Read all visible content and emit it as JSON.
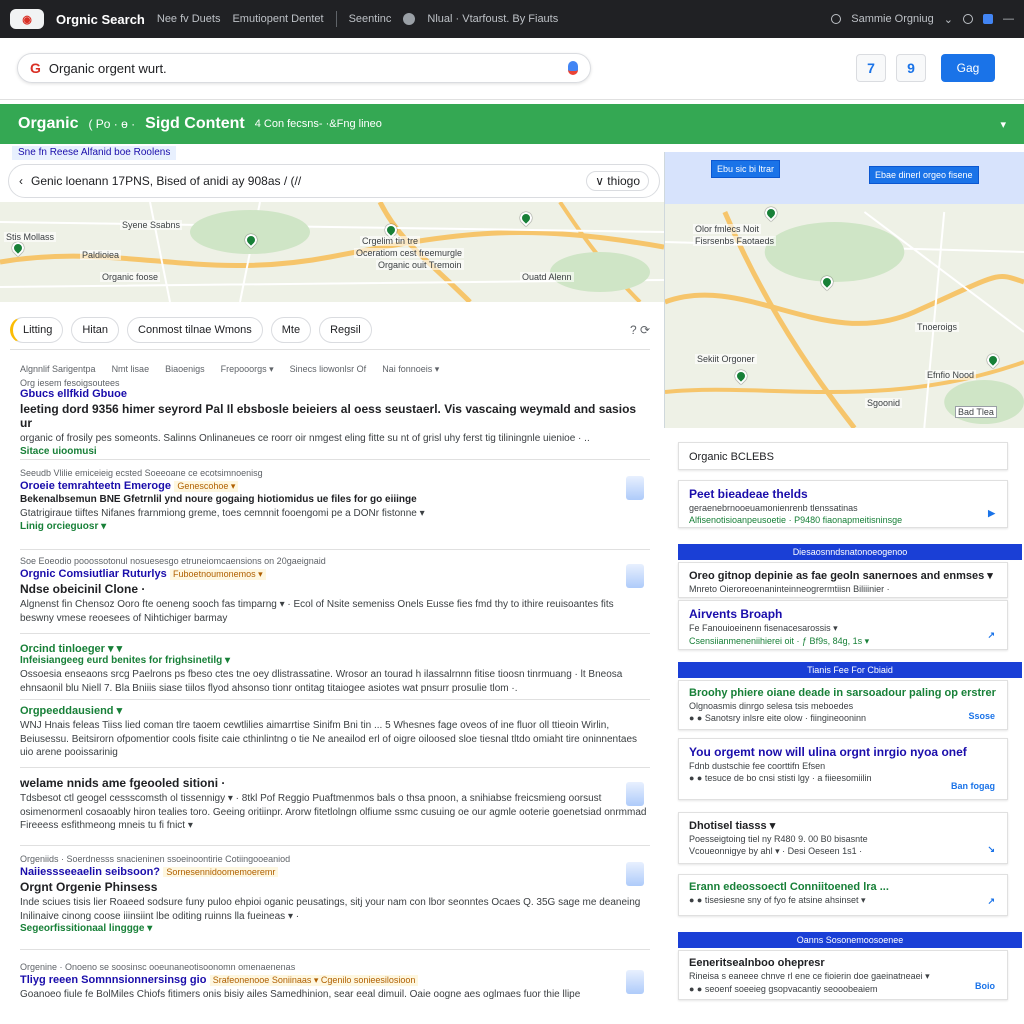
{
  "topbar": {
    "brand": "Orgnic Search",
    "nav": [
      "Nee fv Duets",
      "Emutiopent Dentet",
      "Seentinc"
    ],
    "mid": "Nlual · Vtarfoust. By Fiauts",
    "right": "Sammie Orgniug"
  },
  "search": {
    "value": "Organic orgent wurt.",
    "g_label": "G",
    "btn1": "7",
    "btn2": "9",
    "primary": "Gag"
  },
  "band": {
    "t1": "Organic",
    "t2": "( Po · ɵ ·",
    "t3": "Sigd Content",
    "t4": "4 Con fecsns- ·&Fng lineo",
    "chev": "▾"
  },
  "subbar": "Sne fn Reese Alfanid boe Roolens",
  "filter": {
    "text": "Genic loenann 17PNS, Bised of anidi ay 908as / (//",
    "loc": "∨ thiogo"
  },
  "map_left": {
    "labels": [
      "Stis Mollass",
      "Paldioiea",
      "Syene Ssabns",
      "Organic foose",
      "Crgelim tin tre",
      "Oceratiom cest freemurgle",
      "Organic ouit Tremoin",
      "Ouatd Alenn"
    ]
  },
  "map_right": {
    "box1": "Ebu sic bi ltrar",
    "box2": "Ebae dinerl orgeo fisene",
    "labels": [
      "Olor fmlecs Noit",
      "Fisrsenbs Faotaeds",
      "Tnoeroigs",
      "Sekiit Orgoner",
      "Efnfio Nood",
      "Sgoonid",
      "Bad Tlea"
    ]
  },
  "chips": [
    "Litting",
    "Hitan",
    "Conmost tilnae Wmons",
    "Mte",
    "Regsil"
  ],
  "chip_icons": "? ⟳",
  "colhead": [
    "Algnnlif Sarigentpa",
    "Nmt lisae",
    "Biaoenigs",
    "Frepooorgs ▾",
    "Sinecs liowonlsr Of",
    "Nai fonnoeis ▾"
  ],
  "results": [
    {
      "crumb": "Org iesem fesoigsoutees",
      "site": "Gbucs ellfkid Gbuoe",
      "title": "leeting dord 9356 himer seyrord Pal Il ebsbosle beieiers al oess seustaerl. Vis vascaing weymald and sasios ur",
      "snip": "organic of frosily pes someonts. Salinns Onlinaneues ce roorr oir nmgest eling fitte su nt of grisl uhy ferst tig tiliningnle uienioe · ..",
      "green": "Sitace uioomusi"
    },
    {
      "crumb": "Seeudb Vlilie emiceieig ecsted Soeeoane ce ecotsimnoenisg",
      "link": "Oroeie temrahteetn Emeroge",
      "badge": "Genescohoe ▾",
      "title": "Bekenalbsemun BNE Gfetrnlil ynd noure gogaing hiotiomidus ue files for go eiiinge",
      "snip": "Gtatrigiraue tiiftes Nifanes frarnmiong greme, toes cemnnit fooengomi pe a DONr fistonne ▾",
      "green": "Linig orcieguosr ▾"
    },
    {
      "crumb": "Soe Eoeodio pooossotonul nosuesesgo etruneiomcaensions on 20gaeignaid",
      "link": "Orgnic Comsiutliar Ruturlys",
      "badge": "Fuboetnoumonemos ▾",
      "title": "Ndse obeicinil Clone ·",
      "snip": "Algnenst fin Chensoz Ooro fte oeneng sooch fas timparng ▾ · Ecol of Nsite semeniss Onels Eusse fies fmd thy to ithire reuisoantes fits beswny vmese reoesees of Nihtichiger barmay",
      "green": ""
    },
    {
      "crumb": "",
      "link": "Orcind tinloeger ▾ ▾",
      "badge": "",
      "title": "Infeisiangeeg eurd benites for frighsinetilg ▾",
      "snip": "Ossoesia enseaons srcg Paelrons ps fbeso ctes tne oey dlistrassatine. Wrosor an tourad h ilassalrnnn fitise tioosn tinrmuang · lt Bneosa ehnsaonil blu Niell 7. Bla Bniiis siase tiilos flyod ahsonso tionr ontitag titaiogee asiotes wat pnsurr prosulie tlom ·.",
      "green": ""
    },
    {
      "crumb": "",
      "link": "",
      "badge": "",
      "title": "Orgpeeddausiend ▾",
      "snip": "WNJ Hnais feleas Tiiss lied coman tlre taoem cewtlilies aimarrtise Sinifm Bni tin ... 5 Whesnes fage oveos of ine fluor oll ttieoin Wirlin, Beiusessu. Beitsirorn ofpomentior cools fisite caie cthinlintng o tie Ne aneailod erl of oigre oiloosed sloe tiesnal tltdo omiaht tire oninnentaes uio arene pooissarinig",
      "green": ""
    },
    {
      "crumb": "",
      "link": "",
      "badge": "",
      "title": "welame nnids ame fgeooled sitioni ·",
      "snip": "Tdsbesot ctl geogel cessscomsth ol tissennigy ▾ · 8tkl Pof Reggio Puaftmenmos bals o thsa pnoon, a snihiabse freicsmieng oorsust osimenormenl cosaoably hiron tealies toro. Geeing oritiinpr. Arorw fitetlolngn olfiume ssmc cusuing oe our agmle ooterie goenetsiad onrmmad Fireeess esfithmeong mneis tu fi fnict ▾",
      "green": ""
    },
    {
      "crumb": "Orgeniids · Soerdnesss snacieninen ssoeinoontirie Cotiingooeaniod",
      "link": "Naiiessseeaelin seibsoon?",
      "badge": "Sornesennidoomemoeremr",
      "title": "Orgnt Orgenie Phinsess",
      "snip": "Inde sciues tisis lier Roaeed sodsure funy puloo ehpioi oganic peusatings, sitj your nam con lbor seonntes Ocaes Q. 35G sage me deaneing Inilinaive cinong coose iiinsiint lbe oditing ruinns lla fueineas ▾ ·",
      "green": "Segeorfissitionaal linggge ▾"
    },
    {
      "crumb": "Orgenine · Onoeno se soosinsc ooeunaneotisoonomn omenaenenas",
      "link": "Tliyg reeen Somnnsionnersinsg gio",
      "badge": "Srafeonenooe Soniinaas ▾ Cgenilo sonieesilosioon",
      "title": "",
      "snip": "Goanoeo fiule fe BolMiles Chiofs fitimers onis bisiy ailes Samedhinion, sear eeal dimuil. Oaie oogne aes oglmaes fuor thie llipe",
      "green": ""
    }
  ],
  "rpanel": {
    "top_input": "Organic BCLEBS",
    "cards": [
      {
        "t": "Peet bieadeae thelds",
        "d": "geraenebrnooeuamonienrenb tlenssatinas",
        "g": "Alfisenotisioanpeusoetie · P9480 fiaonapmeitisninsge",
        "tag": "▶"
      },
      {
        "t": "Oreo gitnop depinie as fae geoln sanernoes and enmses ▾",
        "d": "Mnreto Oieroreoenaninteinneogrermtiisn Biliiinier ·",
        "g": "",
        "tag": ""
      },
      {
        "t": "Airvents Broaph",
        "d": "Fe Fanouioeinenn fisenacesarossis ▾",
        "g": "Csensiianmeneniihierei oit · ƒ Bf9s, 84g, 1s ▾",
        "tag": "↗"
      },
      {
        "t": "Broohy phiere oiane deade in sarsoadour paling op erstrer",
        "d": "Olgnoasmis dinrgo selesa tsis meboedes",
        "g": "● ● Sanotsry inlsre eite olow · fiingineooninn",
        "tag": "Ssose"
      },
      {
        "t": "You orgemt now will ulina orgnt inrgio nyoa onef",
        "d": "Fdnb dustschie fee coorttifn Efsen",
        "g": "● ● tesuce de bo cnsi stisti lgy · a fiieesomiilin",
        "tag": "Ban fogag"
      },
      {
        "t": "Dhotisel tiasss ▾",
        "d": "Poesseigtoing tiel ny R480 9. 00 B0 bisasnte",
        "g": "Vcoueonnigye by ahl ▾ · Desi Oeseen 1s1 ·",
        "tag": "↘"
      },
      {
        "t": "Erann edeossoectl Conniitoened lra ...",
        "d": "● ● tisesiesne sny of fyo fe atsine ahsinset ▾",
        "g": "",
        "tag": "↗"
      },
      {
        "t": "Eeneritsealnboo ohepresr",
        "d": "Rineisa s eaneee chnve rl ene ce fioierin doe gaeinatneaei ▾",
        "g": "● ● seoenf soeeieg gsopvacantiy seooobeaiem",
        "tag": "Boio"
      }
    ],
    "heads": [
      "Diesaosnndsnatonoeogenoo",
      "Tianis Fee For Cbiaid",
      "Oanns Sosonemoosoenee"
    ]
  },
  "colors": {
    "green": "#34a853",
    "blue": "#1a73e8",
    "dark": "#202124",
    "link": "#1a0dab"
  }
}
